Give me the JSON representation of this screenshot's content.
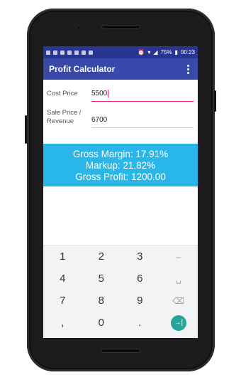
{
  "status_bar": {
    "battery": "75%",
    "time": "00:23"
  },
  "app": {
    "title": "Profit Calculator"
  },
  "form": {
    "cost_label": "Cost Price",
    "cost_value": "5500",
    "sale_label_line1": "Sale Price /",
    "sale_label_line2": "Revenue",
    "sale_value": "6700"
  },
  "results": {
    "gross_margin": "Gross Margin: 17.91%",
    "markup": "Markup: 21.82%",
    "gross_profit": "Gross Profit: 1200.00"
  },
  "keyboard": {
    "rows": [
      [
        "1",
        "2",
        "3",
        "–"
      ],
      [
        "4",
        "5",
        "6",
        "␣"
      ],
      [
        "7",
        "8",
        "9",
        "⌫"
      ],
      [
        ",",
        "0",
        ".",
        "→|"
      ]
    ]
  },
  "colors": {
    "status_bar": "#283593",
    "app_bar": "#3949ab",
    "results_bg": "#29b6e8",
    "focus_underline": "#e91e63",
    "enter_key": "#26a69a"
  }
}
